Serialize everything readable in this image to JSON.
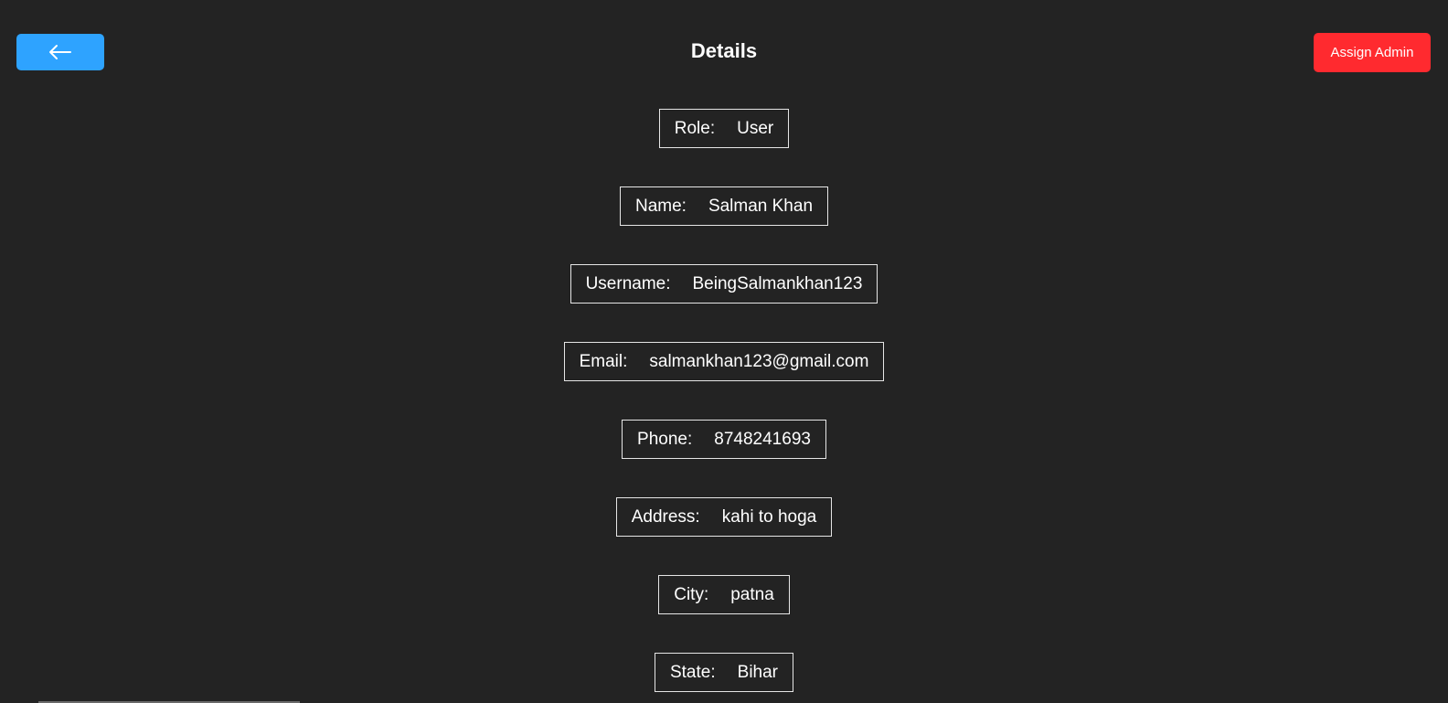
{
  "header": {
    "title": "Details",
    "back_icon": "arrow-left-icon",
    "assign_label": "Assign Admin"
  },
  "colors": {
    "background": "#232323",
    "back_button": "#2ea3ff",
    "assign_button": "#ff2a2f",
    "text": "#ffffff",
    "border": "#e6e6e6"
  },
  "details": [
    {
      "label": "Role:",
      "value": "User"
    },
    {
      "label": "Name:",
      "value": "Salman Khan"
    },
    {
      "label": "Username:",
      "value": "BeingSalmankhan123"
    },
    {
      "label": "Email:",
      "value": "salmankhan123@gmail.com"
    },
    {
      "label": "Phone:",
      "value": "8748241693"
    },
    {
      "label": "Address:",
      "value": "kahi to hoga"
    },
    {
      "label": "City:",
      "value": "patna"
    },
    {
      "label": "State:",
      "value": "Bihar"
    }
  ]
}
